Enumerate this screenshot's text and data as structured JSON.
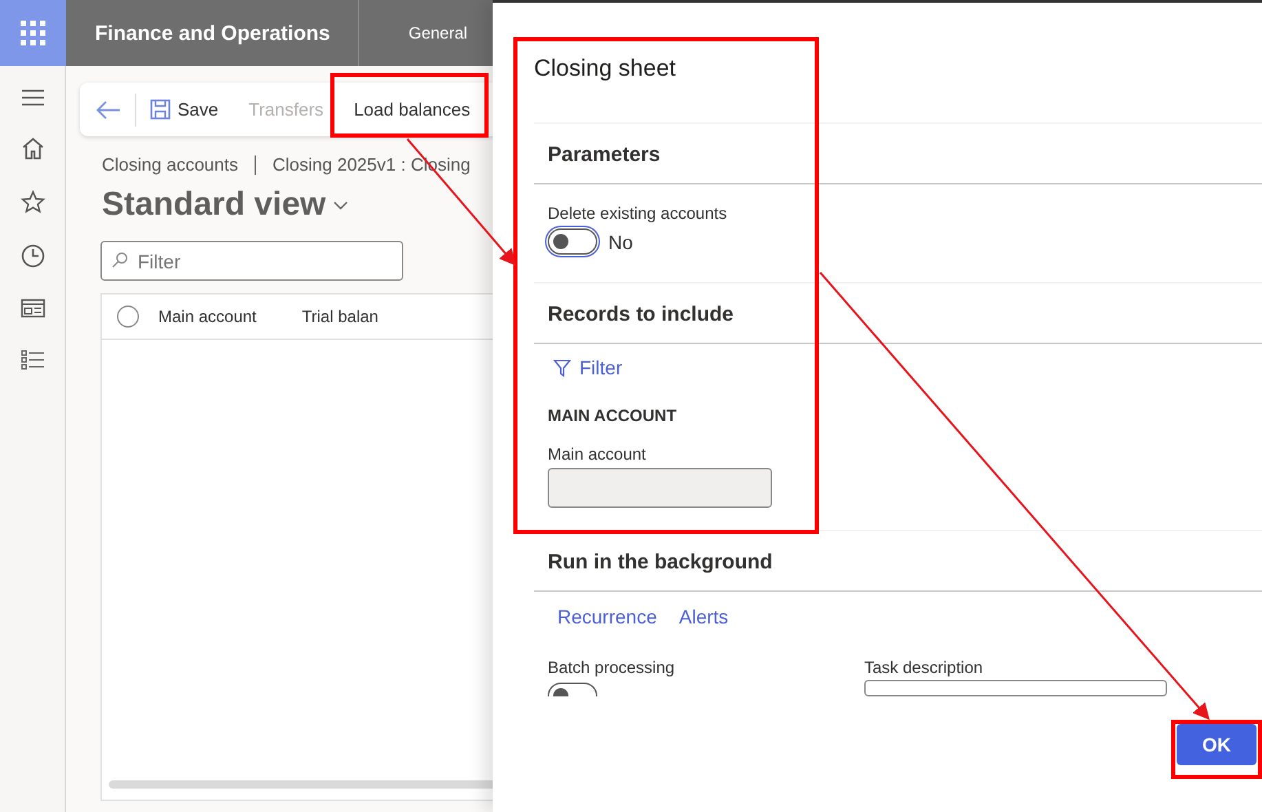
{
  "app_bar": {
    "title": "Finance and Operations",
    "company": "General"
  },
  "toolbar": {
    "buttons": [
      {
        "label": "Save",
        "kind": "save",
        "disabled": false
      },
      {
        "label": "Transfers",
        "kind": "plain",
        "disabled": true
      },
      {
        "label": "Load balances",
        "kind": "plain",
        "disabled": false
      }
    ]
  },
  "breadcrumb": [
    "Closing accounts",
    "Closing 2025v1 : Closing"
  ],
  "view_title": "Standard view",
  "filter": {
    "placeholder": "Filter"
  },
  "grid": {
    "select_all": false,
    "columns": [
      "Main account",
      "Trial balan"
    ]
  },
  "dialog": {
    "title": "Closing sheet",
    "parameters": {
      "title": "Parameters",
      "toggle": {
        "label": "Delete existing accounts",
        "on": false,
        "value": "No"
      }
    },
    "records": {
      "title": "Records to include",
      "filter_link": "Filter",
      "group": "MAIN ACCOUNT",
      "field_label": "Main account"
    },
    "background": {
      "title": "Run in the background",
      "links": [
        "Recurrence",
        "Alerts"
      ],
      "batch": {
        "label": "Batch processing",
        "on": false
      },
      "task": {
        "label": "Task description"
      }
    },
    "ok": "OK"
  }
}
